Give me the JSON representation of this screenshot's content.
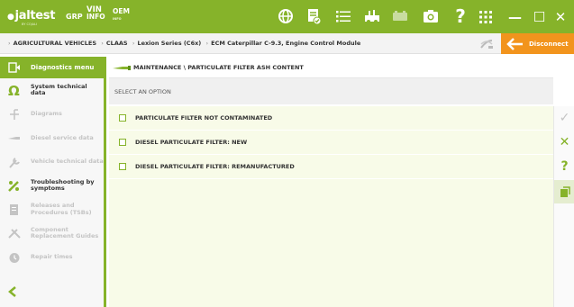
{
  "topbar": {
    "logo": "jaltest",
    "logo_sub": "BY COJALI",
    "grp": "GRP",
    "vin_top": "VIN",
    "vin_bottom": "INFO",
    "oem_top": "OEM",
    "oem_bottom": "INFO",
    "icons": [
      "globe-icon",
      "document-check-icon",
      "list-icon",
      "vehicle-tools-icon",
      "battery-icon",
      "camera-icon",
      "help-icon",
      "grid-icon"
    ],
    "window": {
      "minimize": "—",
      "maximize": "☐",
      "close": "✕"
    }
  },
  "breadcrumb": {
    "items": [
      "AGRICULTURAL VEHICLES",
      "CLAAS",
      "Lexion Series (C6x)",
      "ECM Caterpillar C-9.3, Engine Control Module"
    ],
    "separator": "›"
  },
  "disconnect": {
    "label": "Disconnect"
  },
  "sidebar": {
    "header": "Diagnostics menu",
    "items": [
      {
        "label": "System technical data",
        "icon": "omega-icon",
        "enabled": true
      },
      {
        "label": "Diagrams",
        "icon": "diagram-icon",
        "enabled": false
      },
      {
        "label": "Diesel service data",
        "icon": "injector-icon",
        "enabled": false
      },
      {
        "label": "Vehicle technical data",
        "icon": "wrench-icon",
        "enabled": false
      },
      {
        "label": "Troubleshooting by symptoms",
        "icon": "troubleshooting-icon",
        "enabled": true
      },
      {
        "label": "Releases and Procedures (TSBs)",
        "icon": "document-icon",
        "enabled": false
      },
      {
        "label": "Component Replacement Guides",
        "icon": "tools-icon",
        "enabled": false
      },
      {
        "label": "Repair times",
        "icon": "clock-icon",
        "enabled": false
      }
    ],
    "back_icon": "chevron-left-icon"
  },
  "main": {
    "title": "MAINTENANCE \\ PARTICULATE FILTER ASH CONTENT",
    "select_label": "SELECT AN OPTION",
    "options": [
      "PARTICULATE FILTER NOT CONTAMINATED",
      "DIESEL PARTICULATE FILTER: NEW",
      "DIESEL PARTICULATE FILTER: REMANUFACTURED"
    ]
  },
  "rightbar": {
    "accept": "✓",
    "cancel": "✕",
    "help": "?",
    "report": "report-icon"
  },
  "colors": {
    "green": "#86b32a",
    "dark_green": "#5f8f1a",
    "orange": "#f2941d",
    "light_green_bg": "#f8fbe8"
  }
}
